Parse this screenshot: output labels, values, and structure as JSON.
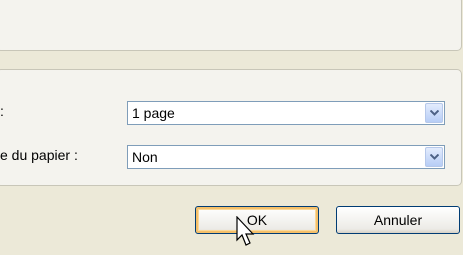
{
  "form": {
    "pages_label": ":",
    "pages_value": "1 page",
    "paper_label": "e du papier :",
    "paper_value": "Non"
  },
  "buttons": {
    "ok": "OK",
    "cancel": "Annuler"
  },
  "icons": {
    "dropdown": "chevron-down-icon",
    "cursor": "arrow-cursor-icon"
  }
}
